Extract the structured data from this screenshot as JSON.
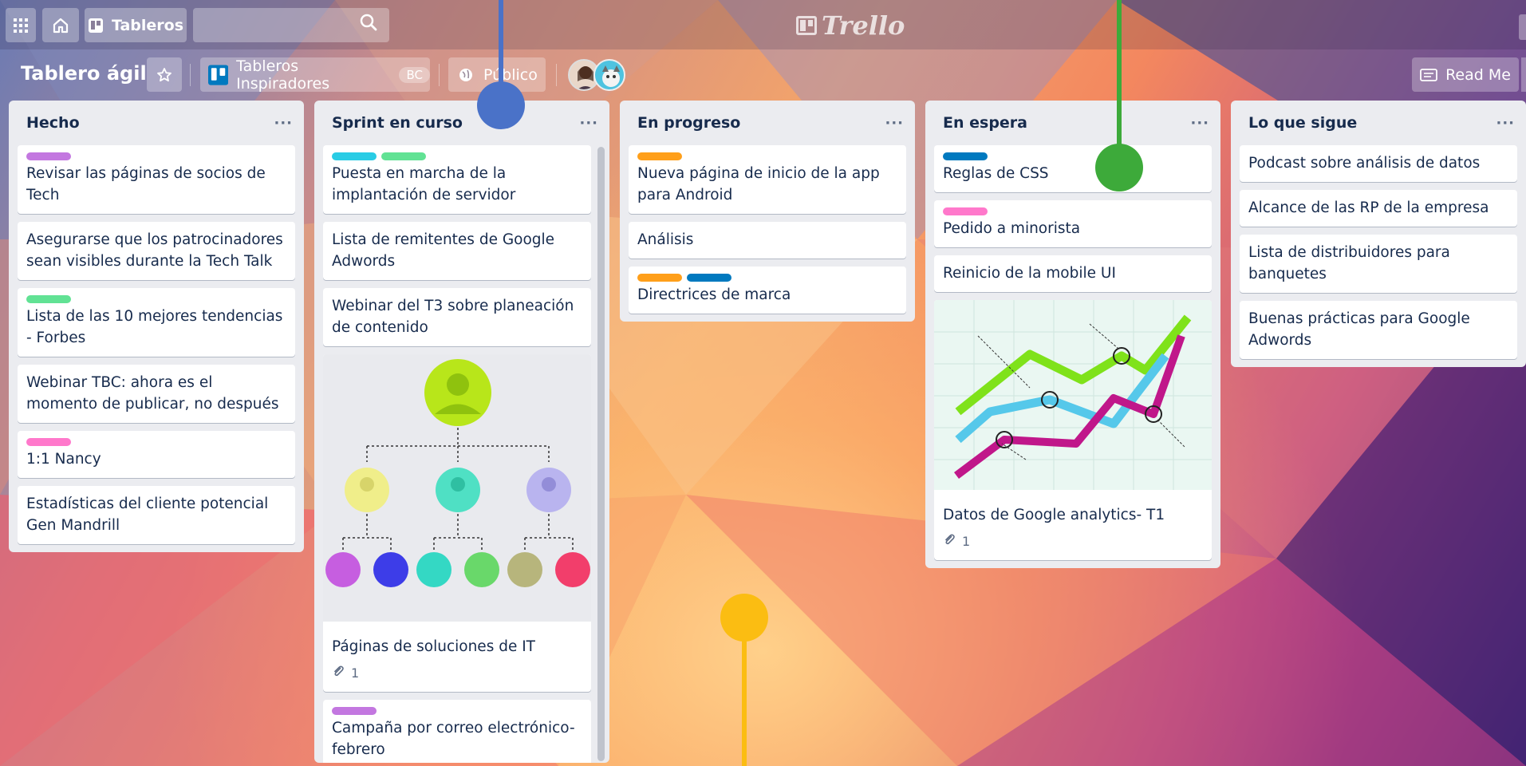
{
  "header": {
    "boards_label": "Tableros",
    "search_placeholder": "",
    "logo_text": "Trello"
  },
  "board": {
    "title": "Tablero ágil",
    "team_name": "Tableros Inspiradores",
    "team_badge": "BC",
    "visibility": "Público",
    "readme_label": "Read Me"
  },
  "colors": {
    "purple": "#c377e0",
    "green": "#61e294",
    "sky": "#29cce5",
    "orange": "#ff9f1a",
    "blue": "#0079bf",
    "pink": "#ff78cb",
    "marker_blue": "#4a72c8",
    "marker_green": "#3daa3a",
    "marker_yellow": "#fbbd12"
  },
  "lists": [
    {
      "title": "Hecho",
      "cards": [
        {
          "labels": [
            "purple"
          ],
          "text": "Revisar las páginas de socios de Tech"
        },
        {
          "labels": [],
          "text": "Asegurarse que los patrocinadores sean visibles durante la Tech Talk"
        },
        {
          "labels": [
            "green"
          ],
          "text": "Lista de las 10 mejores tendencias - Forbes"
        },
        {
          "labels": [],
          "text": "Webinar TBC: ahora es el momento de publicar, no después"
        },
        {
          "labels": [
            "pink"
          ],
          "text": "1:1 Nancy"
        },
        {
          "labels": [],
          "text": "Estadísticas del cliente potencial Gen Mandrill"
        }
      ]
    },
    {
      "title": "Sprint en curso",
      "cards": [
        {
          "labels": [
            "sky",
            "green"
          ],
          "text": "Puesta en marcha de la implantación de servidor"
        },
        {
          "labels": [],
          "text": "Lista de remitentes de Google Adwords"
        },
        {
          "labels": [],
          "text": "Webinar del T3 sobre planeación de contenido"
        },
        {
          "labels": [],
          "cover": "org-chart",
          "text": "Páginas de soluciones de IT",
          "attachments": "1"
        },
        {
          "labels": [
            "purple"
          ],
          "text": "Campaña por correo electrónico- febrero"
        }
      ]
    },
    {
      "title": "En progreso",
      "cards": [
        {
          "labels": [
            "orange"
          ],
          "text": "Nueva página de inicio de la app para Android"
        },
        {
          "labels": [],
          "text": "Análisis"
        },
        {
          "labels": [
            "orange",
            "blue"
          ],
          "text": "Directrices de marca"
        }
      ]
    },
    {
      "title": "En espera",
      "cards": [
        {
          "labels": [
            "blue"
          ],
          "text": "Reglas de CSS"
        },
        {
          "labels": [
            "pink"
          ],
          "text": "Pedido a minorista"
        },
        {
          "labels": [],
          "text": "Reinicio de la mobile UI"
        },
        {
          "labels": [],
          "cover": "line-chart",
          "text": "Datos de Google analytics- T1",
          "attachments": "1"
        }
      ]
    },
    {
      "title": "Lo que sigue",
      "cards": [
        {
          "labels": [],
          "text": "Podcast sobre análisis de datos"
        },
        {
          "labels": [],
          "text": "Alcance de las RP de la empresa"
        },
        {
          "labels": [],
          "text": "Lista de distribuidores para banquetes"
        },
        {
          "labels": [],
          "text": "Buenas prácticas para Google Adwords"
        }
      ]
    }
  ],
  "list_menu_glyph": "···",
  "attachment_icon": "paperclip-icon"
}
